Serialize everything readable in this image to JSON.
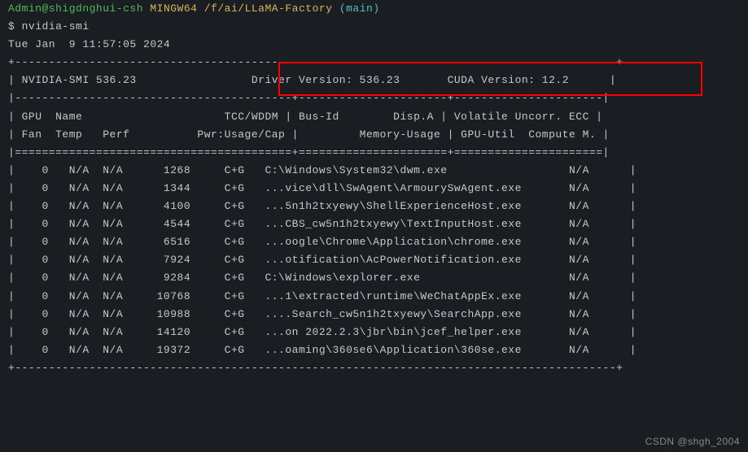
{
  "prompt": {
    "user_host": "Admin@shigdnghui-csh",
    "shell": "MINGW64",
    "path": "/f/ai/LLaMA-Factory",
    "branch": "(main)",
    "symbol": "$",
    "command": "nvidia-smi"
  },
  "timestamp": "Tue Jan  9 11:57:05 2024",
  "header": {
    "smi_label": "NVIDIA-SMI",
    "smi_version": "536.23",
    "driver_label": "Driver Version:",
    "driver_version": "536.23",
    "cuda_label": "CUDA Version:",
    "cuda_version": "12.2"
  },
  "columns": {
    "row1_left": " GPU  Name                     TCC/WDDM ",
    "row1_mid": " Bus-Id        Disp.A ",
    "row1_right": " Volatile Uncorr. ECC ",
    "row2_left": " Fan  Temp   Perf          Pwr:Usage/Cap ",
    "row2_mid": "         Memory-Usage ",
    "row2_right": " GPU-Util  Compute M. "
  },
  "processes": [
    {
      "gpu": "0",
      "gi": "N/A",
      "ci": "N/A",
      "pid": "1268",
      "type": "C+G",
      "name": "C:\\Windows\\System32\\dwm.exe",
      "mem": "N/A"
    },
    {
      "gpu": "0",
      "gi": "N/A",
      "ci": "N/A",
      "pid": "1344",
      "type": "C+G",
      "name": "...vice\\dll\\SwAgent\\ArmourySwAgent.exe",
      "mem": "N/A"
    },
    {
      "gpu": "0",
      "gi": "N/A",
      "ci": "N/A",
      "pid": "4100",
      "type": "C+G",
      "name": "...5n1h2txyewy\\ShellExperienceHost.exe",
      "mem": "N/A"
    },
    {
      "gpu": "0",
      "gi": "N/A",
      "ci": "N/A",
      "pid": "4544",
      "type": "C+G",
      "name": "...CBS_cw5n1h2txyewy\\TextInputHost.exe",
      "mem": "N/A"
    },
    {
      "gpu": "0",
      "gi": "N/A",
      "ci": "N/A",
      "pid": "6516",
      "type": "C+G",
      "name": "...oogle\\Chrome\\Application\\chrome.exe",
      "mem": "N/A"
    },
    {
      "gpu": "0",
      "gi": "N/A",
      "ci": "N/A",
      "pid": "7924",
      "type": "C+G",
      "name": "...otification\\AcPowerNotification.exe",
      "mem": "N/A"
    },
    {
      "gpu": "0",
      "gi": "N/A",
      "ci": "N/A",
      "pid": "9284",
      "type": "C+G",
      "name": "C:\\Windows\\explorer.exe",
      "mem": "N/A"
    },
    {
      "gpu": "0",
      "gi": "N/A",
      "ci": "N/A",
      "pid": "10768",
      "type": "C+G",
      "name": "...1\\extracted\\runtime\\WeChatAppEx.exe",
      "mem": "N/A"
    },
    {
      "gpu": "0",
      "gi": "N/A",
      "ci": "N/A",
      "pid": "10988",
      "type": "C+G",
      "name": "....Search_cw5n1h2txyewy\\SearchApp.exe",
      "mem": "N/A"
    },
    {
      "gpu": "0",
      "gi": "N/A",
      "ci": "N/A",
      "pid": "14120",
      "type": "C+G",
      "name": "...on 2022.2.3\\jbr\\bin\\jcef_helper.exe",
      "mem": "N/A"
    },
    {
      "gpu": "0",
      "gi": "N/A",
      "ci": "N/A",
      "pid": "19372",
      "type": "C+G",
      "name": "...oaming\\360se6\\Application\\360se.exe",
      "mem": "N/A"
    }
  ],
  "watermark": "CSDN @shgh_2004"
}
